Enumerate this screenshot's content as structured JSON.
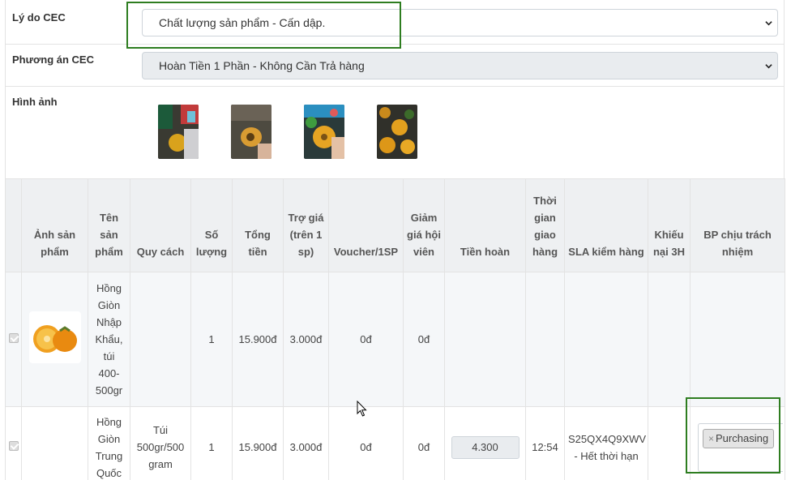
{
  "form": {
    "reason": {
      "label": "Lý do CEC",
      "value": "Chất lượng sản phẩm - Cấn dập."
    },
    "plan": {
      "label": "Phương án CEC",
      "value": "Hoàn Tiền 1 Phần - Không Cần Trả hàng"
    },
    "images": {
      "label": "Hình ảnh"
    }
  },
  "table": {
    "headers": [
      "",
      "Ảnh sản phẩm",
      "Tên sản phẩm",
      "Quy cách",
      "Số lượng",
      "Tổng tiền",
      "Trợ giá (trên 1 sp)",
      "Voucher/1SP",
      "Giảm giá hội viên",
      "Tiền hoàn",
      "Thời gian giao hàng",
      "SLA kiểm hàng",
      "Khiếu nại 3H",
      "BP chịu trách nhiệm"
    ],
    "rows": [
      {
        "name": "Hồng Giòn Nhập Khẩu, túi 400-500gr",
        "spec": "",
        "qty": "1",
        "total": "15.900đ",
        "subsidy": "3.000đ",
        "voucher": "0đ",
        "member_discount": "0đ",
        "refund": "",
        "delivery_time": "",
        "sla": "",
        "complaint": "",
        "department": ""
      },
      {
        "name": "Hồng Giòn Trung Quốc",
        "spec": "Túi 500gr/500 gram",
        "qty": "1",
        "total": "15.900đ",
        "subsidy": "3.000đ",
        "voucher": "0đ",
        "member_discount": "0đ",
        "refund": "4.300",
        "delivery_time": "12:54",
        "sla": "S25QX4Q9XWV - Hết thời hạn",
        "complaint": "",
        "department": "Purchasing"
      }
    ]
  },
  "colors": {
    "highlight": "#2e7d20",
    "header_bg": "#eef0f2",
    "tag_bg": "#e4e4e4"
  }
}
